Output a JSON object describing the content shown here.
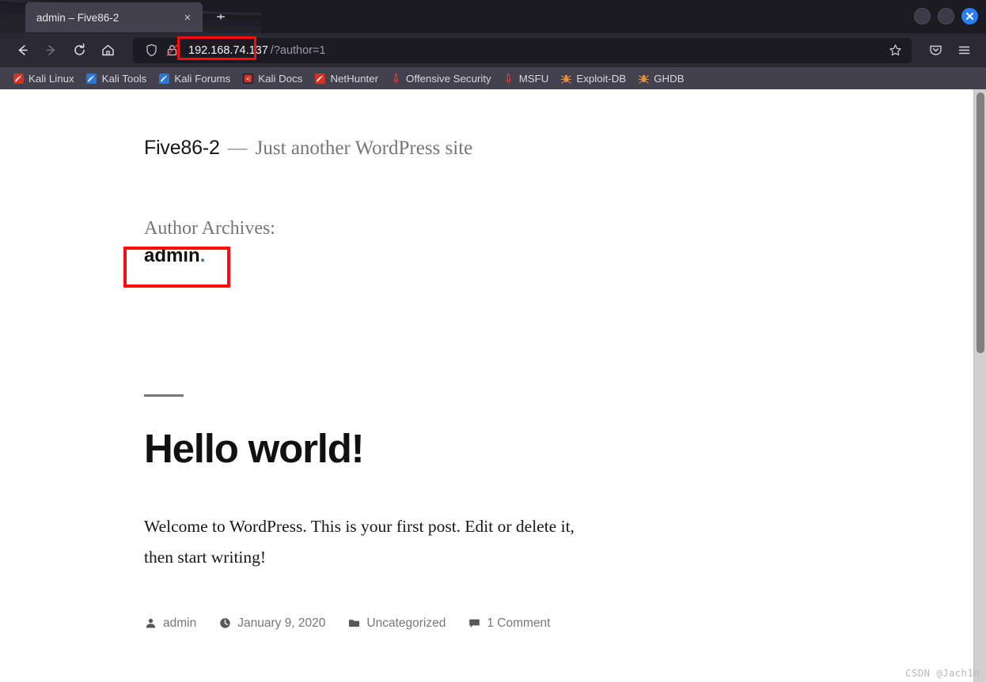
{
  "browser": {
    "tab": {
      "title": "admin – Five86-2",
      "close_label": "×"
    },
    "new_tab_label": "+",
    "window_controls": {
      "minimize": "minimize",
      "maximize": "maximize",
      "close": "close"
    },
    "nav": {
      "back": "Back",
      "forward": "Forward",
      "reload": "Reload",
      "home": "Home"
    },
    "url": {
      "host": "192.168.74.137",
      "path": "/?author=1",
      "full": "192.168.74.137/?author=1",
      "highlight_color": "#fb0d0d",
      "shield_icon": "tracking-protection-shield",
      "lock_icon": "insecure-connection-lock",
      "star_icon": "bookmark-star"
    },
    "toolbar_right": {
      "pocket": "Save to Pocket",
      "menu": "Open application menu"
    },
    "bookmarks": [
      {
        "label": "Kali Linux",
        "icon": "kali-dragon-icon"
      },
      {
        "label": "Kali Tools",
        "icon": "kali-tools-icon"
      },
      {
        "label": "Kali Forums",
        "icon": "kali-forums-icon"
      },
      {
        "label": "Kali Docs",
        "icon": "kali-docs-icon"
      },
      {
        "label": "NetHunter",
        "icon": "nethunter-icon"
      },
      {
        "label": "Offensive Security",
        "icon": "offsec-icon"
      },
      {
        "label": "MSFU",
        "icon": "msfu-icon"
      },
      {
        "label": "Exploit-DB",
        "icon": "exploit-db-icon"
      },
      {
        "label": "GHDB",
        "icon": "ghdb-icon"
      }
    ]
  },
  "page": {
    "site_title": "Five86-2",
    "site_separator": "—",
    "site_tagline": "Just another WordPress site",
    "archive_prefix": "Author Archives:",
    "archive_name": "admin",
    "archive_dot": ".",
    "post": {
      "title": "Hello world!",
      "body": "Welcome to WordPress. This is your first post. Edit or delete it, then start writing!",
      "meta": [
        {
          "icon": "author-person-icon",
          "text": "admin"
        },
        {
          "icon": "clock-icon",
          "text": "January 9, 2020"
        },
        {
          "icon": "folder-icon",
          "text": "Uncategorized"
        },
        {
          "icon": "comment-icon",
          "text": "1 Comment"
        }
      ]
    }
  },
  "watermark": "CSDN @Jach1n"
}
